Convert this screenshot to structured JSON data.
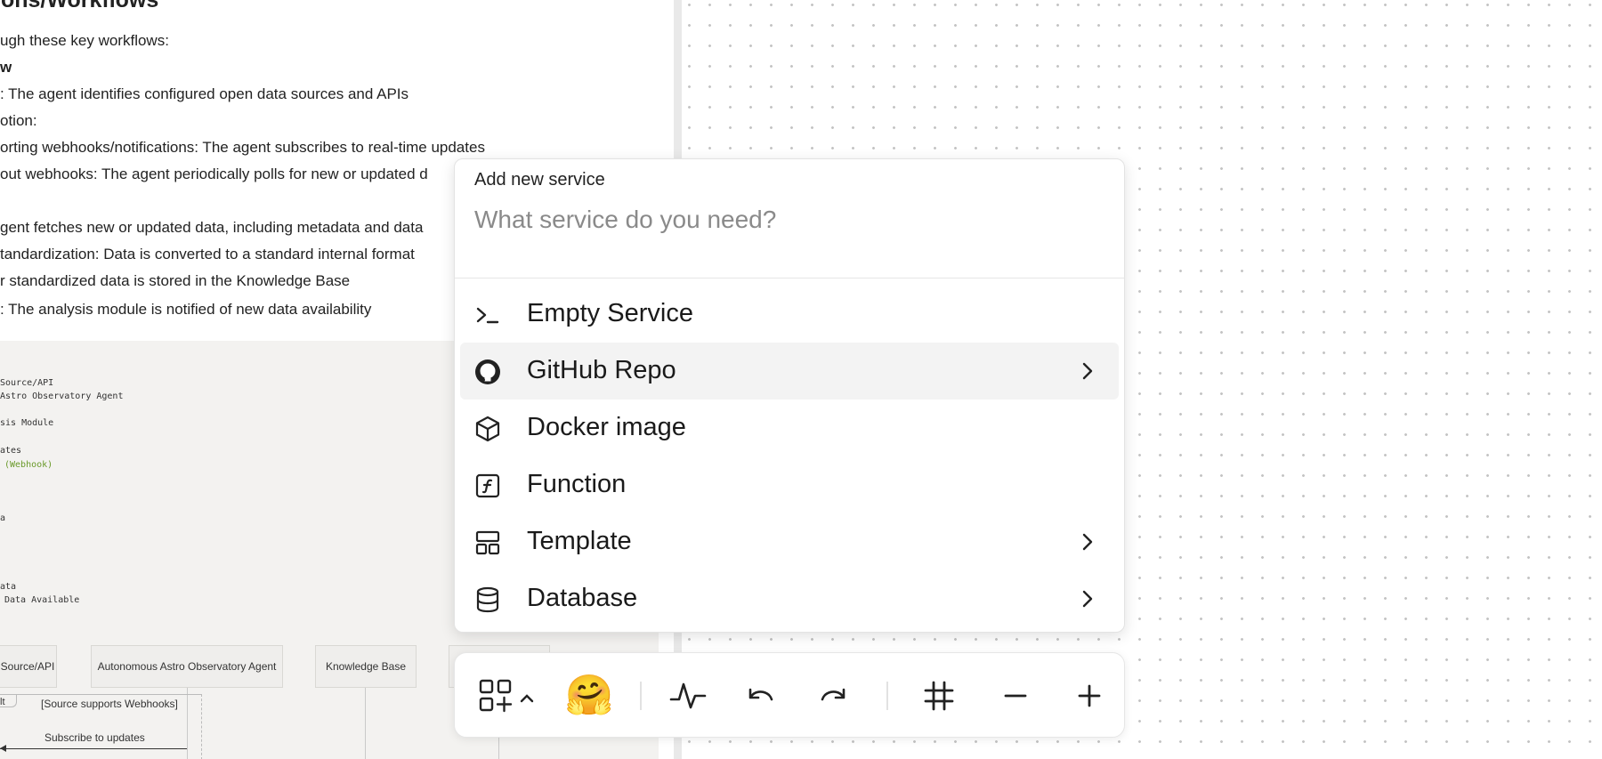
{
  "document": {
    "heading": "ions/Workflows",
    "lines": [
      "ugh these key workflows:",
      "w",
      ": The agent identifies configured open data sources and APIs",
      "otion:",
      "orting webhooks/notifications: The agent subscribes to real-time updates",
      "out webhooks: The agent periodically polls for new or updated d",
      "gent fetches new or updated data, including metadata and data",
      "tandardization: Data is converted to a standard internal format",
      "r standardized data is stored in the Knowledge Base",
      ": The analysis module is notified of new data availability"
    ]
  },
  "diagram": {
    "code_lines": [
      "Source/API",
      "Astro Observatory Agent",
      "sis Module",
      "ates",
      "(Webhook)",
      "a",
      "ata",
      "Data Available"
    ],
    "participants": [
      "Source/API",
      "Autonomous Astro Observatory Agent",
      "Knowledge Base"
    ],
    "alt_label": "lt",
    "alt_condition": "[Source supports Webhooks]",
    "message": "Subscribe to updates"
  },
  "popup": {
    "title": "Add new service",
    "search_placeholder": "What service do you need?",
    "search_value": "",
    "items": [
      {
        "label": "Empty Service",
        "icon": "terminal-icon",
        "has_submenu": false
      },
      {
        "label": "GitHub Repo",
        "icon": "github-icon",
        "has_submenu": true,
        "highlighted": true
      },
      {
        "label": "Docker image",
        "icon": "cube-icon",
        "has_submenu": false
      },
      {
        "label": "Function",
        "icon": "function-icon",
        "has_submenu": false
      },
      {
        "label": "Template",
        "icon": "template-icon",
        "has_submenu": true
      },
      {
        "label": "Database",
        "icon": "database-icon",
        "has_submenu": true
      }
    ]
  },
  "toolbar": {
    "buttons": [
      "add-widget-icon",
      "hugging-face-emoji",
      "activity-icon",
      "undo-icon",
      "redo-icon",
      "grid-icon",
      "zoom-out-icon",
      "zoom-in-icon"
    ],
    "emoji": "🤗"
  },
  "colors": {
    "highlight": "#f3f3f3",
    "canvas_dot": "#c4c4c4",
    "diagram_bg": "#f3f2f0",
    "green_text": "#6a9a2a"
  }
}
